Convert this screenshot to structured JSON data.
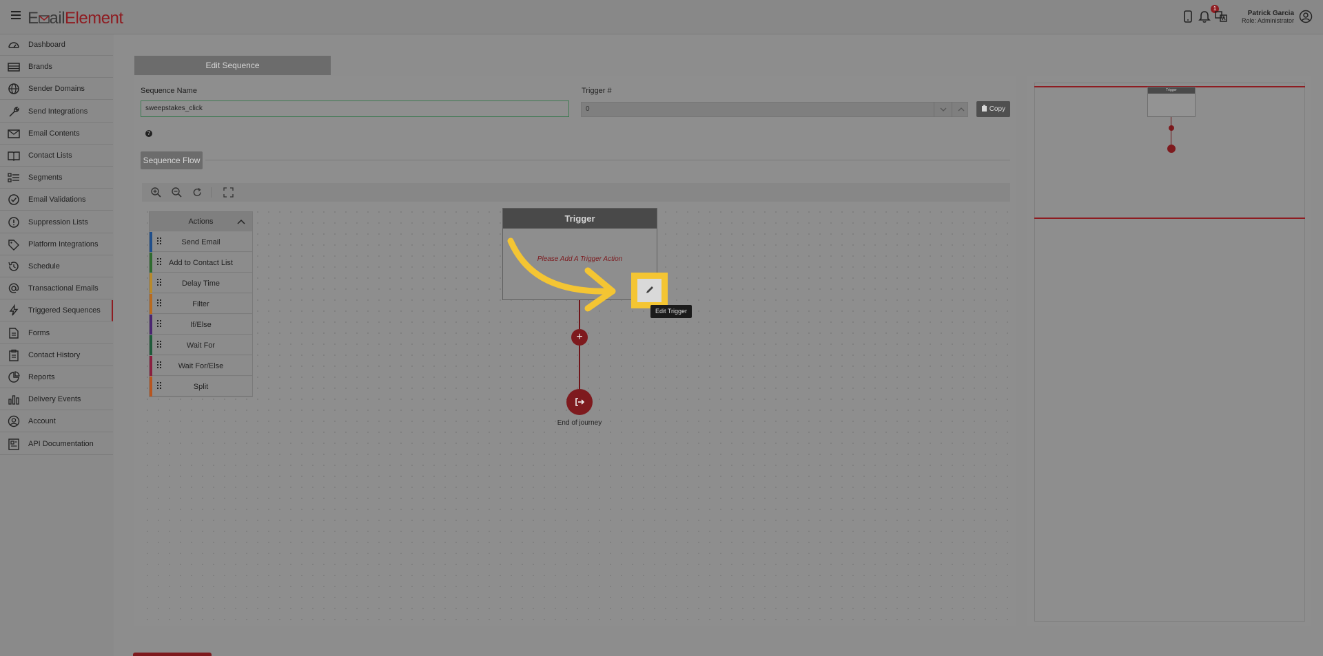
{
  "app": {
    "logo_prefix": "E",
    "logo_mid": "ail",
    "logo_brand": "Element"
  },
  "header": {
    "user_name": "Patrick Garcia",
    "user_role": "Role: Administrator",
    "notification_count": "1"
  },
  "sidebar": {
    "items": [
      {
        "label": "Dashboard",
        "icon": "dashboard-icon"
      },
      {
        "label": "Brands",
        "icon": "brands-icon"
      },
      {
        "label": "Sender Domains",
        "icon": "globe-icon"
      },
      {
        "label": "Send Integrations",
        "icon": "wrench-icon"
      },
      {
        "label": "Email Contents",
        "icon": "envelope-icon"
      },
      {
        "label": "Contact Lists",
        "icon": "book-icon"
      },
      {
        "label": "Segments",
        "icon": "list-icon"
      },
      {
        "label": "Email Validations",
        "icon": "check-circle-icon"
      },
      {
        "label": "Suppression Lists",
        "icon": "alert-circle-icon"
      },
      {
        "label": "Platform Integrations",
        "icon": "tag-icon"
      },
      {
        "label": "Schedule",
        "icon": "history-icon"
      },
      {
        "label": "Transactional Emails",
        "icon": "at-icon"
      },
      {
        "label": "Triggered Sequences",
        "icon": "bolt-icon"
      },
      {
        "label": "Forms",
        "icon": "form-icon"
      },
      {
        "label": "Contact History",
        "icon": "clipboard-icon"
      },
      {
        "label": "Reports",
        "icon": "pie-chart-icon"
      },
      {
        "label": "Delivery Events",
        "icon": "bar-chart-icon"
      },
      {
        "label": "Account",
        "icon": "user-circle-icon"
      },
      {
        "label": "API Documentation",
        "icon": "document-icon"
      }
    ]
  },
  "page": {
    "tab_label": "Edit Sequence",
    "sequence_name_label": "Sequence Name",
    "sequence_name_value": "sweepstakes_click",
    "trigger_label": "Trigger #",
    "trigger_value": "0",
    "copy_label": "Copy",
    "help_glyph": "?",
    "flow_tab_label": "Sequence Flow"
  },
  "actions_panel": {
    "title": "Actions",
    "items": [
      {
        "label": "Send Email",
        "color": "#1f4e8a"
      },
      {
        "label": "Add to Contact List",
        "color": "#2f6b2f"
      },
      {
        "label": "Delay Time",
        "color": "#b8892a"
      },
      {
        "label": "Filter",
        "color": "#b86a1f"
      },
      {
        "label": "If/Else",
        "color": "#4a2570"
      },
      {
        "label": "Wait For",
        "color": "#1f5a3a"
      },
      {
        "label": "Wait For/Else",
        "color": "#8a1f3f"
      },
      {
        "label": "Split",
        "color": "#b8551f"
      }
    ]
  },
  "flow": {
    "trigger_title": "Trigger",
    "trigger_message": "Please Add A Trigger Action",
    "add_glyph": "+",
    "end_label": "End of journey",
    "edit_tooltip": "Edit Trigger"
  },
  "minimap": {
    "node_title": "Trigger"
  },
  "colors": {
    "brand": "#8e1c21",
    "highlight": "#f4c533"
  }
}
